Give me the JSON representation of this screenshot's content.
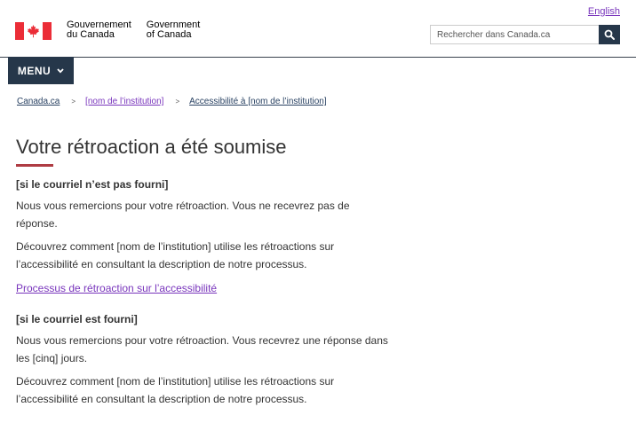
{
  "header": {
    "language_link": "English",
    "signature_fr": [
      "Gouvernement",
      "du Canada"
    ],
    "signature_en": [
      "Government",
      "of Canada"
    ],
    "search_placeholder": "Rechercher dans Canada.ca",
    "search_icon": "search-icon",
    "flag_icon": "canada-flag-icon",
    "colors": {
      "flag_red": "#eb2d37",
      "nav_dark": "#26374a",
      "visited_link": "#7834bc",
      "accent_bar": "#af3c43"
    }
  },
  "menu": {
    "label": "MENU",
    "icon": "chevron-down-icon"
  },
  "breadcrumb": {
    "items": [
      "Canada.ca",
      "[nom de l’institution]",
      "Accessibilité à [nom de l’institution]"
    ],
    "separator": ">"
  },
  "main": {
    "title": "Votre rétroaction a été soumise",
    "section1": {
      "heading": "[si le courriel n’est pas fourni]",
      "para1": "Nous vous remercions pour votre rétroaction. Vous ne recevrez pas de réponse.",
      "para2": "Découvrez comment [nom de l’institution] utilise les rétroactions sur l’accessibilité en consultant la description de notre processus.",
      "link": "Processus de rétroaction sur l’accessibilité"
    },
    "section2": {
      "heading": "[si le courriel est fourni]",
      "para1": "Nous vous remercions pour votre rétroaction. Vous recevrez une réponse dans les [cinq] jours.",
      "para2": "Découvrez comment [nom de l’institution] utilise les rétroactions sur l’accessibilité en consultant la description de notre processus."
    }
  }
}
